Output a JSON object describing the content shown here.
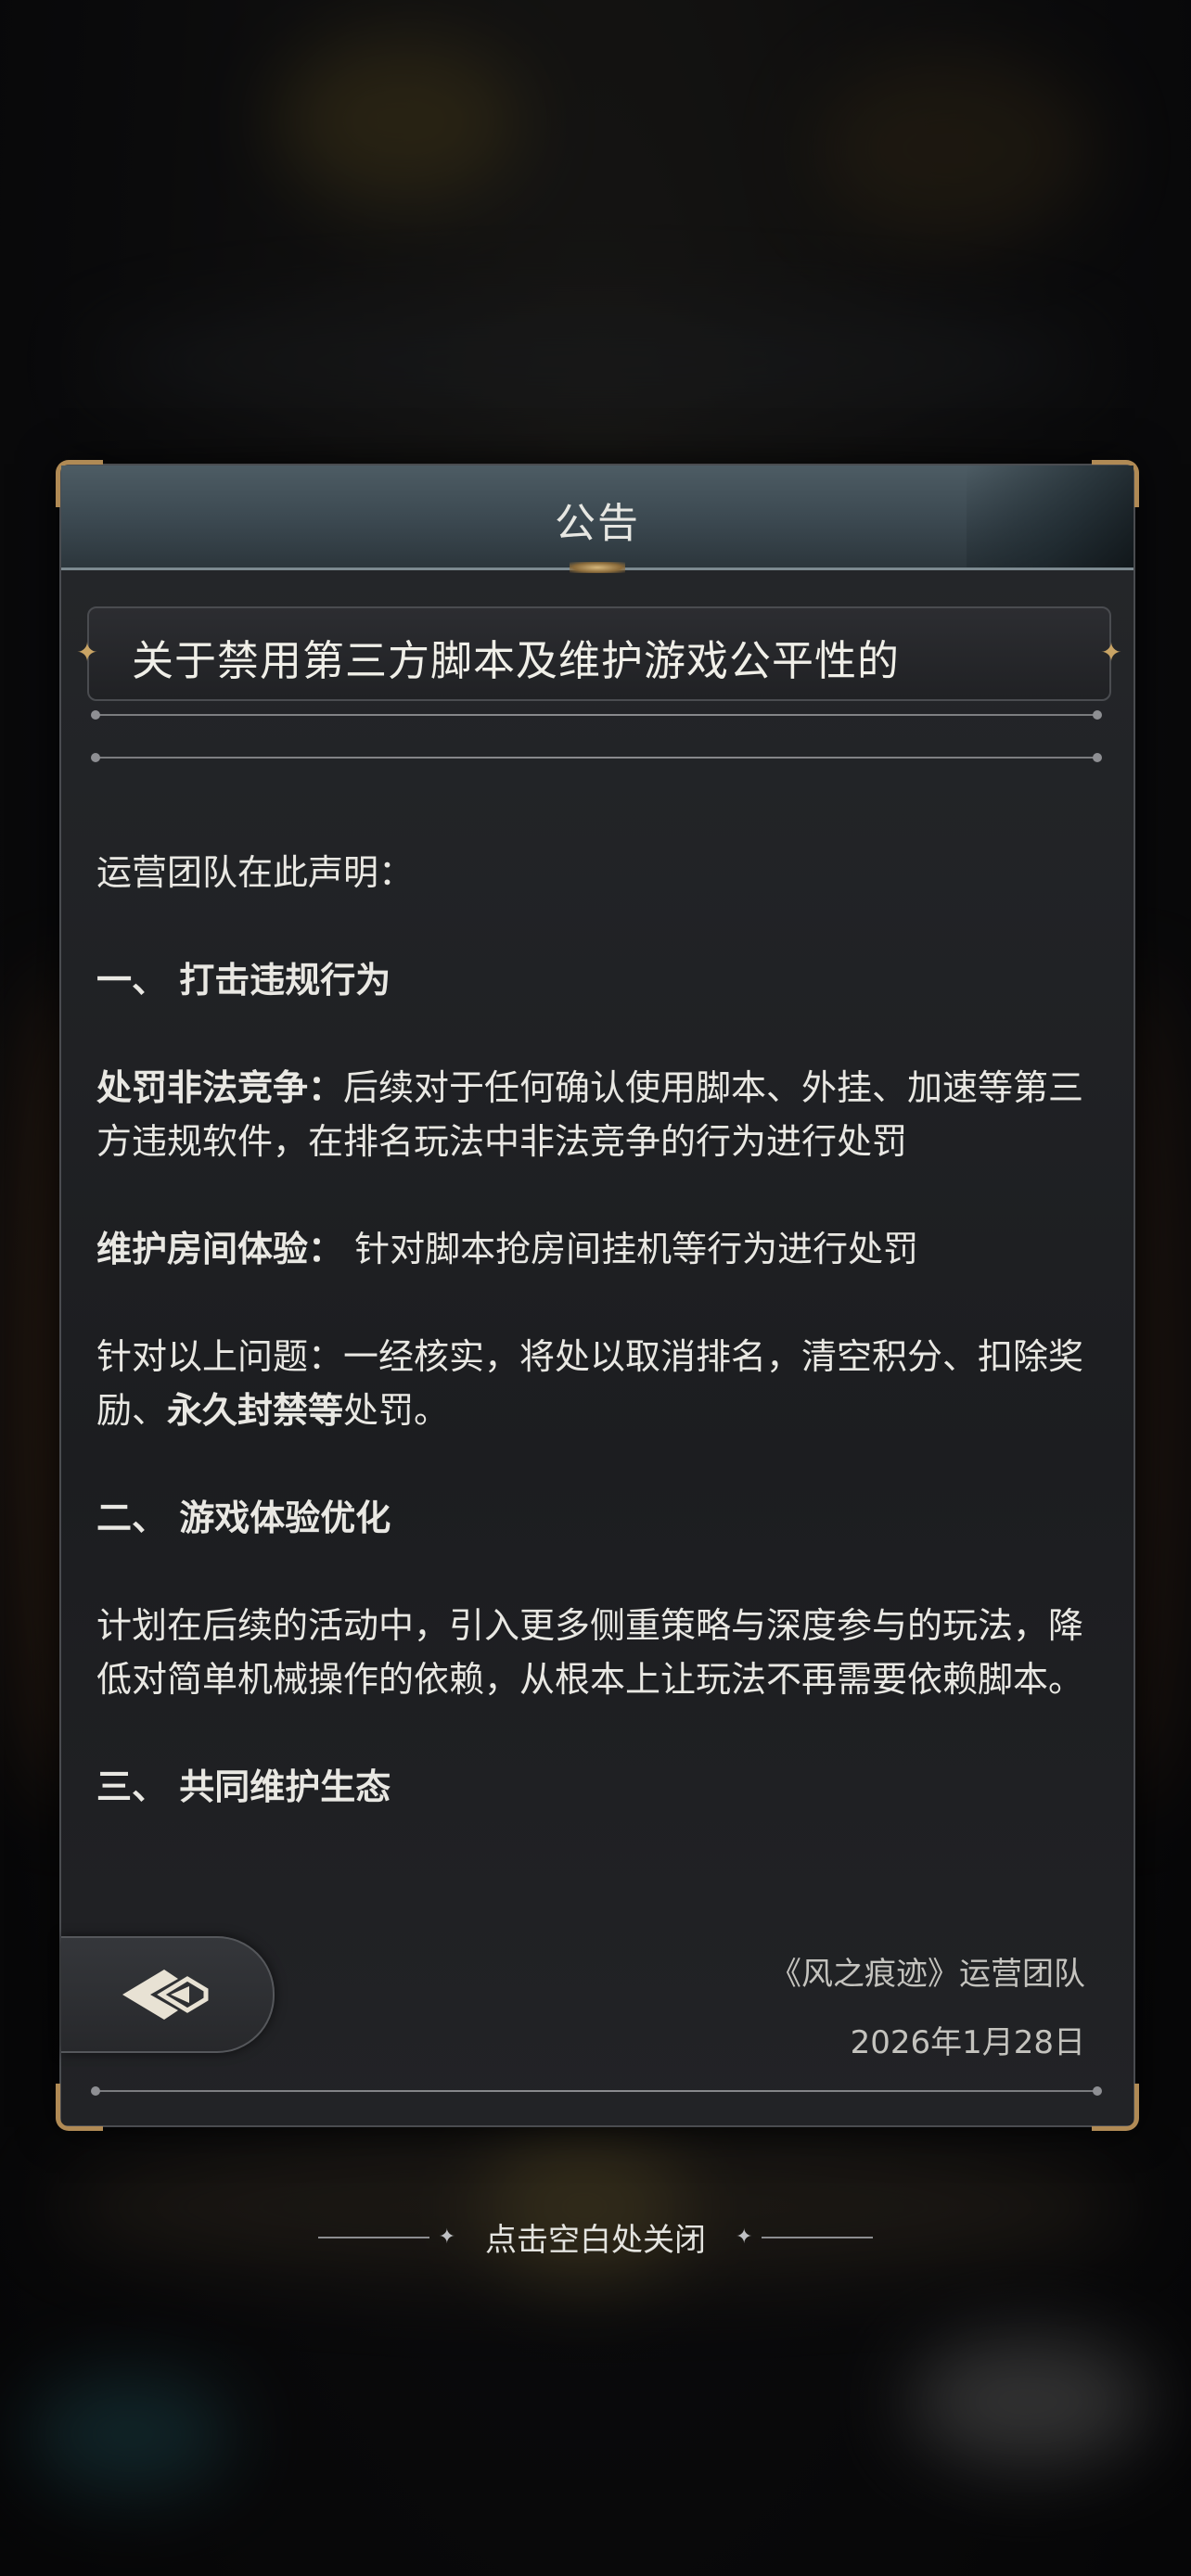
{
  "panel": {
    "title": "公告",
    "subject": "关于禁用第三方脚本及维护游戏公平性的"
  },
  "content": {
    "intro": "运营团队在此声明：",
    "section1_heading": "一、 打击违规行为",
    "penalty_label": "处罚非法竞争：",
    "penalty_text": "后续对于任何确认使用脚本、外挂、加速等第三方违规软件，在排名玩法中非法竞争的行为进行处罚",
    "room_label": "维护房间体验：",
    "room_text": " 针对脚本抢房间挂机等行为进行处罚",
    "measures_prefix": "针对以上问题：一经核实，将处以取消排名，清空积分、扣除奖励、",
    "measures_bold": "永久封禁等",
    "measures_suffix": "处罚。",
    "section2_heading": "二、 游戏体验优化",
    "section2_text": "计划在后续的活动中，引入更多侧重策略与深度参与的玩法，降低对简单机械操作的依赖，从根本上让玩法不再需要依赖脚本。",
    "section3_heading": "三、 共同维护生态"
  },
  "signature": {
    "team": "《风之痕迹》运营团队",
    "date": "2026年1月28日"
  },
  "close_hint": "点击空白处关闭",
  "icons": {
    "back": "back-arrow-icon",
    "ornament": "ornament-icon"
  },
  "colors": {
    "header": "#3b4850",
    "accent_gold": "#b08a55",
    "text": "#e9e8e3"
  }
}
